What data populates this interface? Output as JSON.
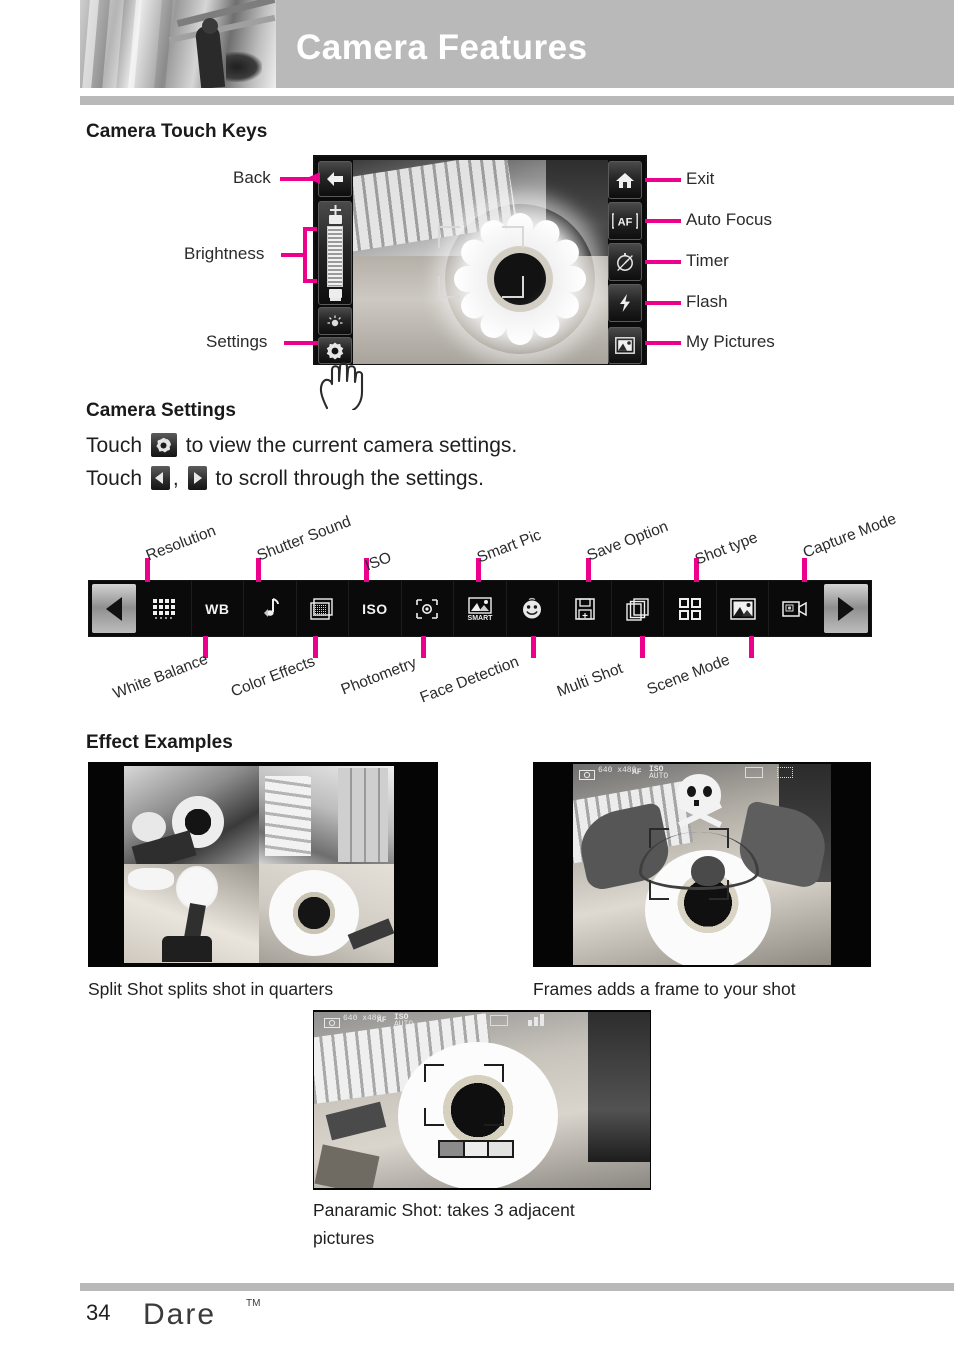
{
  "header": {
    "title": "Camera Features",
    "photo_alt": "grayscale-photo-strip"
  },
  "sections": {
    "touch_keys_heading": "Camera Touch Keys",
    "settings_heading": "Camera Settings",
    "effects_heading": "Effect Examples"
  },
  "touch_keys": {
    "left_labels": [
      {
        "label": "Back",
        "icon": "back-arrow-icon"
      },
      {
        "label": "Brightness",
        "icon": "brightness-slider-icon"
      },
      {
        "label": "Settings",
        "icon": "gear-icon"
      }
    ],
    "right_labels": [
      {
        "label": "Exit",
        "icon": "home-icon"
      },
      {
        "label": "Auto Focus",
        "icon": "af-icon"
      },
      {
        "label": "Timer",
        "icon": "timer-icon"
      },
      {
        "label": "Flash",
        "icon": "flash-icon"
      },
      {
        "label": "My Pictures",
        "icon": "my-pictures-icon"
      }
    ]
  },
  "settings_text": {
    "line1_pre": "Touch",
    "line1_post": "to view the current camera settings.",
    "line2_pre": "Touch",
    "line2_mid": ",",
    "line2_post": "to scroll through the settings."
  },
  "settings_bar": {
    "prev_label": "prev-arrow",
    "next_label": "next-arrow",
    "icons": [
      {
        "name": "resolution-icon",
        "label": "Resolution",
        "side": "top",
        "glyph": "grid-dots"
      },
      {
        "name": "white-balance-icon",
        "label": "White Balance",
        "side": "bottom",
        "glyph": "WB"
      },
      {
        "name": "shutter-sound-icon",
        "label": "Shutter Sound",
        "side": "top",
        "glyph": "note"
      },
      {
        "name": "color-effects-icon",
        "label": "Color Effects",
        "side": "bottom",
        "glyph": "frame-dots"
      },
      {
        "name": "iso-icon",
        "label": "ISO",
        "side": "top",
        "glyph": "ISO"
      },
      {
        "name": "photometry-icon",
        "label": "Photometry",
        "side": "bottom",
        "glyph": "metering"
      },
      {
        "name": "smart-pic-icon",
        "label": "Smart Pic",
        "side": "top",
        "glyph": "SMART"
      },
      {
        "name": "face-detection-icon",
        "label": "Face Detection",
        "side": "bottom",
        "glyph": "smiley"
      },
      {
        "name": "save-option-icon",
        "label": "Save Option",
        "side": "top",
        "glyph": "floppy"
      },
      {
        "name": "multi-shot-icon",
        "label": "Multi Shot",
        "side": "bottom",
        "glyph": "stack"
      },
      {
        "name": "shot-type-icon",
        "label": "Shot type",
        "side": "top",
        "glyph": "four-squares"
      },
      {
        "name": "scene-mode-icon",
        "label": "Scene Mode",
        "side": "bottom",
        "glyph": "landscape"
      },
      {
        "name": "capture-mode-icon",
        "label": "Capture Mode",
        "side": "top",
        "glyph": "camcorder"
      }
    ]
  },
  "effects": [
    {
      "name": "split-shot-example",
      "caption": "Split Shot splits shot in quarters"
    },
    {
      "name": "frames-example",
      "caption": "Frames adds a frame to your shot"
    },
    {
      "name": "panoramic-example",
      "caption_line1": "Panaramic Shot: takes 3 adjacent",
      "caption_line2": "pictures"
    }
  ],
  "osd": {
    "resolution": "640 x480",
    "af": "AF",
    "iso_label": "ISO",
    "iso_value": "AUTO",
    "memory": "mem",
    "battery": "battery"
  },
  "footer": {
    "page": "34",
    "brand": "Dare",
    "tm": "TM"
  },
  "colors": {
    "accent": "#ec008c",
    "header_gray": "#b9b9b9",
    "text": "#231f20"
  }
}
